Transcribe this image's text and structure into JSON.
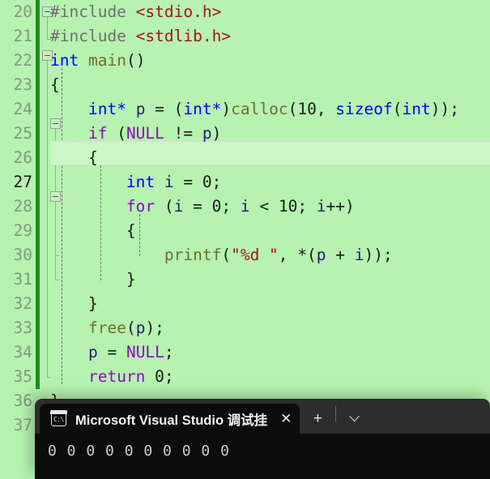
{
  "editor": {
    "background_color": "#b6f2b0",
    "current_line": 27,
    "change_bar_color": "#1f8b1f",
    "lines": [
      {
        "num": "20",
        "text": "#include <stdio.h>"
      },
      {
        "num": "21",
        "text": "#include <stdlib.h>"
      },
      {
        "num": "22",
        "text": "int main()"
      },
      {
        "num": "23",
        "text": "{"
      },
      {
        "num": "24",
        "text": "    int* p = (int*)calloc(10, sizeof(int));"
      },
      {
        "num": "25",
        "text": "    if (NULL != p)"
      },
      {
        "num": "26",
        "text": "    {"
      },
      {
        "num": "27",
        "text": "        int i = 0;"
      },
      {
        "num": "28",
        "text": "        for (i = 0; i < 10; i++)"
      },
      {
        "num": "29",
        "text": "        {"
      },
      {
        "num": "30",
        "text": "            printf(\"%d \", *(p + i));"
      },
      {
        "num": "31",
        "text": "        }"
      },
      {
        "num": "32",
        "text": "    }"
      },
      {
        "num": "33",
        "text": "    free(p);"
      },
      {
        "num": "34",
        "text": "    p = NULL;"
      },
      {
        "num": "35",
        "text": "    return 0;"
      },
      {
        "num": "36",
        "text": "}"
      },
      {
        "num": "37",
        "text": ""
      }
    ]
  },
  "terminal": {
    "tab": {
      "icon_label": "C:\\",
      "title": "Microsoft Visual Studio 调试挂",
      "close_label": "✕"
    },
    "new_tab_label": "+",
    "dropdown_label": "chevron-down",
    "output": "0 0 0 0 0 0 0 0 0 0",
    "background_color": "#0c0c0c",
    "titlebar_color": "#2d2d2d"
  }
}
